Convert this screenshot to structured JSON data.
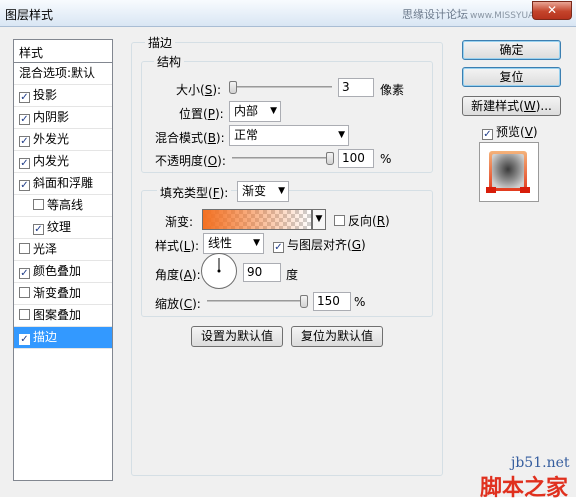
{
  "window": {
    "title": "图层样式",
    "watermark_top": "思缘设计论坛",
    "watermark_site": "www.MISSYUAN.COM",
    "close_glyph": "✕"
  },
  "sidebar": {
    "header": "样式",
    "items": [
      {
        "label": "混合选项:默认",
        "checkbox": false,
        "checked": false,
        "selected": false,
        "sub": false
      },
      {
        "label": "投影",
        "checkbox": true,
        "checked": true,
        "selected": false,
        "sub": false
      },
      {
        "label": "内阴影",
        "checkbox": true,
        "checked": true,
        "selected": false,
        "sub": false
      },
      {
        "label": "外发光",
        "checkbox": true,
        "checked": true,
        "selected": false,
        "sub": false
      },
      {
        "label": "内发光",
        "checkbox": true,
        "checked": true,
        "selected": false,
        "sub": false
      },
      {
        "label": "斜面和浮雕",
        "checkbox": true,
        "checked": true,
        "selected": false,
        "sub": false
      },
      {
        "label": "等高线",
        "checkbox": true,
        "checked": false,
        "selected": false,
        "sub": true
      },
      {
        "label": "纹理",
        "checkbox": true,
        "checked": true,
        "selected": false,
        "sub": true
      },
      {
        "label": "光泽",
        "checkbox": true,
        "checked": false,
        "selected": false,
        "sub": false
      },
      {
        "label": "颜色叠加",
        "checkbox": true,
        "checked": true,
        "selected": false,
        "sub": false
      },
      {
        "label": "渐变叠加",
        "checkbox": true,
        "checked": false,
        "selected": false,
        "sub": false
      },
      {
        "label": "图案叠加",
        "checkbox": true,
        "checked": false,
        "selected": false,
        "sub": false
      },
      {
        "label": "描边",
        "checkbox": true,
        "checked": true,
        "selected": true,
        "sub": false
      }
    ]
  },
  "stroke": {
    "group_title": "描边",
    "structure_title": "结构",
    "size_label": "大小(",
    "size_key": "S",
    "size_value": "3",
    "size_unit": "像素",
    "position_label": "位置(",
    "position_key": "P",
    "position_value": "内部",
    "blend_label": "混合模式(",
    "blend_key": "B",
    "blend_value": "正常",
    "opacity_label": "不透明度(",
    "opacity_key": "O",
    "opacity_value": "100",
    "opacity_unit": "%",
    "fill_type_label": "填充类型(",
    "fill_type_key": "F",
    "fill_type_value": "渐变",
    "gradient_label": "渐变:",
    "reverse_label": "反向(",
    "reverse_key": "R",
    "style_label": "样式(",
    "style_key": "L",
    "style_value": "线性",
    "align_label": "与图层对齐(",
    "align_key": "G",
    "angle_label": "角度(",
    "angle_key": "A",
    "angle_value": "90",
    "angle_unit": "度",
    "scale_label": "缩放(",
    "scale_key": "C",
    "scale_value": "150",
    "scale_unit": "%",
    "make_default": "设置为默认值",
    "reset_default": "复位为默认值",
    "close_paren": "):",
    "close_paren_plain": ")"
  },
  "right": {
    "ok": "确定",
    "reset": "复位",
    "new_style_prefix": "新建样式(",
    "new_style_key": "W",
    "new_style_suffix": ")...",
    "preview_prefix": "预览(",
    "preview_key": "V",
    "preview_suffix": ")"
  },
  "watermark": {
    "site": "jb51.net",
    "brand": "脚本之家"
  },
  "colors": {
    "accent": "#3399ff",
    "gradient": "#f37021"
  }
}
